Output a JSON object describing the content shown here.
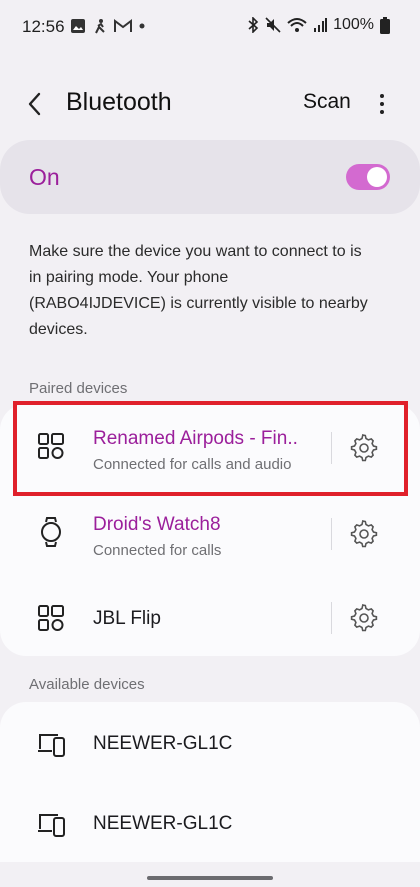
{
  "status_bar": {
    "time": "12:56",
    "battery_pct": "100%",
    "left_icons": [
      "gallery-icon",
      "activity-icon",
      "gmail-icon",
      "dot-icon"
    ],
    "right_icons": [
      "bluetooth-icon",
      "mute-icon",
      "wifi-icon",
      "signal-icon",
      "battery-icon"
    ]
  },
  "header": {
    "title": "Bluetooth",
    "scan_label": "Scan"
  },
  "toggle": {
    "label": "On",
    "state": true,
    "accent": "#d36ad0"
  },
  "info_text": "Make sure the device you want to connect to is in pairing mode. Your phone (RABO4IJDEVICE) is currently visible to nearby devices.",
  "paired": {
    "label": "Paired devices",
    "devices": [
      {
        "name": "Renamed Airpods - Fin..",
        "status": "Connected for calls and audio",
        "icon": "multi-device-icon"
      },
      {
        "name": "Droid's Watch8",
        "status": "Connected for calls",
        "icon": "watch-icon"
      },
      {
        "name": "JBL Flip",
        "status": "",
        "icon": "multi-device-icon"
      }
    ]
  },
  "available": {
    "label": "Available devices",
    "devices": [
      {
        "name": "NEEWER-GL1C",
        "icon": "computer-phone-icon"
      },
      {
        "name": "NEEWER-GL1C",
        "icon": "computer-phone-icon"
      }
    ]
  },
  "colors": {
    "accent_text": "#9b1f9b",
    "highlight": "#e0202b"
  }
}
